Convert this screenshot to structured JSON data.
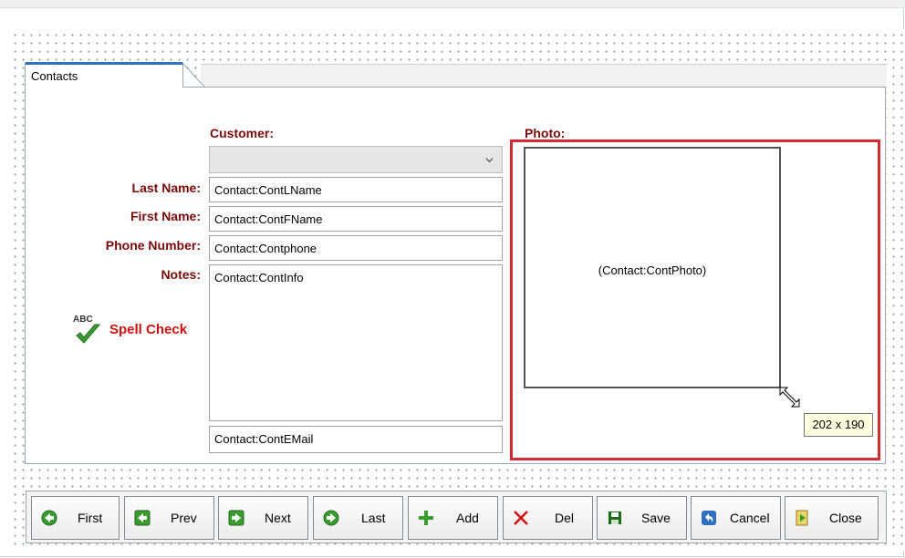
{
  "tab": {
    "label": "Contacts"
  },
  "form": {
    "customer_label": "Customer:",
    "last_name_label": "Last Name:",
    "first_name_label": "First Name:",
    "phone_label": "Phone Number:",
    "notes_label": "Notes:",
    "photo_label": "Photo:",
    "last_name_value": "Contact:ContLName",
    "first_name_value": "Contact:ContFName",
    "phone_value": "Contact:Contphone",
    "notes_value": "Contact:ContInfo",
    "email_value": "Contact:ContEMail",
    "customer_value": "",
    "photo_placeholder": "(Contact:ContPhoto)",
    "size_tooltip": "202 x 190"
  },
  "spell_check": {
    "icon_text": "ABC",
    "label": "Spell Check"
  },
  "toolbar": {
    "buttons": [
      {
        "label": "First",
        "icon": "circle-arrow-left-icon"
      },
      {
        "label": "Prev",
        "icon": "square-arrow-left-icon"
      },
      {
        "label": "Next",
        "icon": "square-arrow-right-icon"
      },
      {
        "label": "Last",
        "icon": "circle-arrow-right-icon"
      },
      {
        "label": "Add",
        "icon": "plus-icon"
      },
      {
        "label": "Del",
        "icon": "x-icon"
      },
      {
        "label": "Save",
        "icon": "floppy-icon"
      },
      {
        "label": "Cancel",
        "icon": "undo-icon"
      },
      {
        "label": "Close",
        "icon": "door-exit-icon"
      }
    ]
  },
  "colors": {
    "accent_tab": "#2c73c4",
    "label_red": "#7a0a0a",
    "selection_red": "#d52a33",
    "spell_red": "#d01010",
    "icon_green": "#3a9b2e"
  }
}
